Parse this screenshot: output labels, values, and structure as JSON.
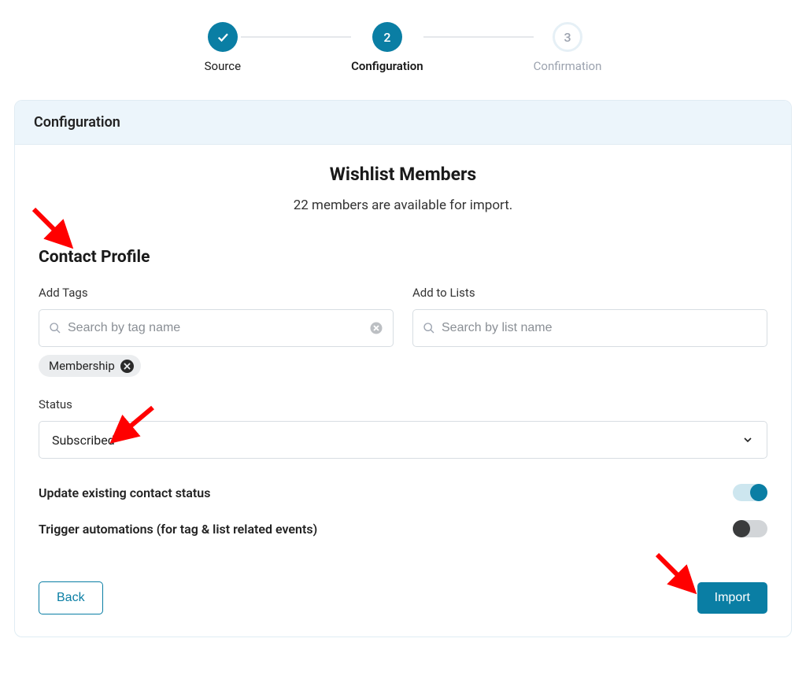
{
  "stepper": {
    "steps": [
      {
        "label": "Source"
      },
      {
        "label": "Configuration",
        "number": "2"
      },
      {
        "label": "Confirmation",
        "number": "3"
      }
    ]
  },
  "card": {
    "header": "Configuration",
    "title": "Wishlist Members",
    "subtitle": "22 members are available for import."
  },
  "profile": {
    "section_title": "Contact Profile",
    "tags": {
      "label": "Add Tags",
      "placeholder": "Search by tag name",
      "chip": "Membership"
    },
    "lists": {
      "label": "Add to Lists",
      "placeholder": "Search by list name"
    },
    "status": {
      "label": "Status",
      "value": "Subscribed"
    },
    "update_toggle": "Update existing contact status",
    "trigger_toggle": "Trigger automations (for tag & list related events)"
  },
  "actions": {
    "back": "Back",
    "import": "Import"
  }
}
